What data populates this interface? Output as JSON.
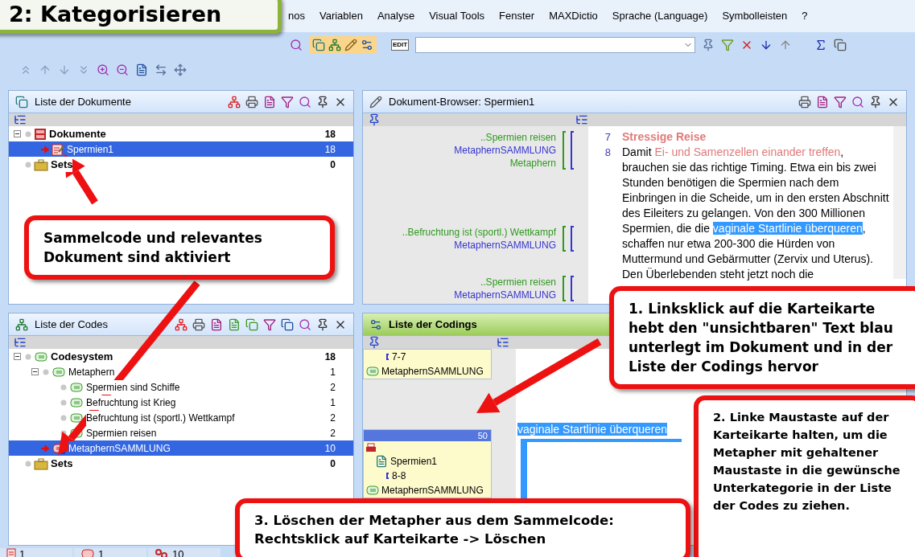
{
  "banner": {
    "title": "2: Kategorisieren"
  },
  "menu": [
    "nos",
    "Variablen",
    "Analyse",
    "Visual Tools",
    "Fenster",
    "MAXDictio",
    "Sprache (Language)",
    "Symbolleisten",
    "?"
  ],
  "toolbar": {
    "edit_label": "EDIT"
  },
  "documents_panel": {
    "title": "Liste der Dokumente",
    "tree": [
      {
        "label": "Dokumente",
        "kind": "documents",
        "count": "18",
        "selected": false,
        "children": [
          {
            "label": "Spermien1",
            "kind": "document",
            "count": "18",
            "selected": true
          }
        ]
      },
      {
        "label": "Sets",
        "kind": "set",
        "count": "0",
        "selected": false
      }
    ]
  },
  "browser": {
    "title": "Dokument-Browser: Spermien1",
    "margin_groups": [
      [
        {
          "label": "..Spermien reisen",
          "color": "#2e9a1e"
        },
        {
          "label": "MetaphernSAMMLUNG",
          "color": "#3535d0"
        },
        {
          "label": "Metaphern",
          "color": "#2e9a1e"
        }
      ],
      [
        {
          "label": "..Befruchtung ist (sportl.) Wettkampf",
          "color": "#2e9a1e"
        },
        {
          "label": "MetaphernSAMMLUNG",
          "color": "#3535d0"
        }
      ],
      [
        {
          "label": "..Spermien reisen",
          "color": "#2e9a1e"
        },
        {
          "label": "MetaphernSAMMLUNG",
          "color": "#3535d0"
        }
      ]
    ],
    "paragraphs": [
      {
        "number": "7",
        "segments": [
          {
            "kind": "heading",
            "text": "Stressige Reise"
          }
        ]
      },
      {
        "number": "8",
        "segments": [
          {
            "kind": "plain",
            "text": "Damit "
          },
          {
            "kind": "faint",
            "text": "Ei- und Samenzellen einander treffen"
          },
          {
            "kind": "plain",
            "text": ", brauchen sie das richtige Timing. Etwa ein bis zwei Stunden benötigen die Spermien nach dem Einbringen in die Scheide, um in den ersten Abschnitt des Eileiters zu gelangen. Von den 300 Millionen Spermien, die die "
          },
          {
            "kind": "highlight",
            "text": "vaginale Startlinie überqueren"
          },
          {
            "kind": "plain",
            "text": ", schaffen nur etwa 200-300 die Hürden von Muttermund und Gebärmutter (Zervix und Uterus). Den Überlebenden steht jetzt noch die"
          }
        ]
      }
    ]
  },
  "codes_panel": {
    "title": "Liste der Codes",
    "tree": [
      {
        "label": "Codesystem",
        "kind": "codesystem",
        "count": "18",
        "selected": false,
        "children": [
          {
            "label": "Metaphern",
            "kind": "code",
            "count": "1",
            "selected": false,
            "children": [
              {
                "label": "Spermien sind Schiffe",
                "kind": "code",
                "count": "2",
                "selected": false
              },
              {
                "label": "Befruchtung ist Krieg",
                "kind": "code",
                "count": "1",
                "selected": false
              },
              {
                "label": "Befruchtung ist (sportl.) Wettkampf",
                "kind": "code",
                "count": "2",
                "selected": false
              },
              {
                "label": "Spermien reisen",
                "kind": "code",
                "count": "2",
                "selected": false
              }
            ]
          },
          {
            "label": "MetaphernSAMMLUNG",
            "kind": "collector",
            "count": "10",
            "selected": true
          }
        ]
      },
      {
        "label": "Sets",
        "kind": "set",
        "count": "0",
        "selected": false
      }
    ]
  },
  "codings_panel": {
    "title": "Liste der Codings",
    "cards": [
      {
        "segment": "7-7",
        "code": "MetaphernSAMMLUNG"
      },
      {
        "document": "Spermien1",
        "segment": "8-8",
        "code": "MetaphernSAMMLUNG",
        "weight": "50"
      }
    ],
    "preview": "vaginale Startlinie überqueren"
  },
  "status_bar": [
    {
      "kind": "documents",
      "count": "1"
    },
    {
      "kind": "codes",
      "count": "1"
    },
    {
      "kind": "codings",
      "count": "10"
    }
  ],
  "callouts": [
    {
      "text": "Sammelcode und relevantes Dokument sind aktiviert"
    },
    {
      "text": "1. Linksklick auf die Karteikarte hebt den \"unsichtbaren\" Text blau unterlegt im Dokument und in der Liste der Codings hervor"
    },
    {
      "text": "2. Linke Maustaste auf der Karteikarte halten, um die Metapher mit gehaltener Maustaste in die gewünsche Unterkategorie in der Liste der Codes zu ziehen."
    },
    {
      "text": "3. Löschen der Metapher aus dem Sammelcode: Rechtsklick auf Karteikarte -> Löschen"
    }
  ]
}
